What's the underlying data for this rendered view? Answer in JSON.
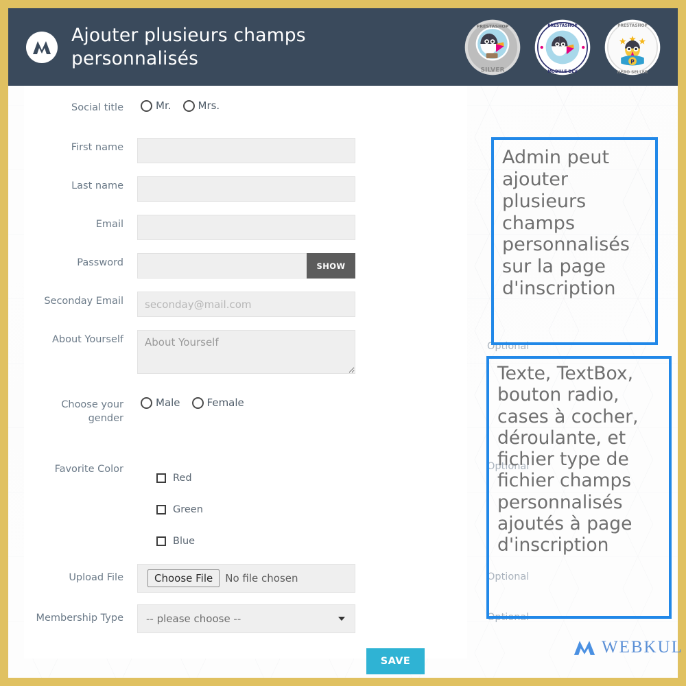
{
  "header": {
    "title": "Ajouter plusieurs champs personnalisés",
    "logo_icon": "webkul-w-icon",
    "badges": [
      {
        "icon": "prestashop-partner-silver-badge",
        "top_text": "PRESTASHOP PARTNER",
        "bottom_text": "SILVER"
      },
      {
        "icon": "prestashop-partner-module-developer-badge",
        "top_text": "PRESTASHOP PARTNER",
        "bottom_text": "MODULE DEVELOPER"
      },
      {
        "icon": "prestashop-super-hero-seller-badge",
        "top_text": "PRESTASHOP",
        "bottom_text": "SUPER HERO SELLER"
      }
    ]
  },
  "form": {
    "social_title": {
      "label": "Social title",
      "options": [
        {
          "label": "Mr.",
          "selected": false
        },
        {
          "label": "Mrs.",
          "selected": false
        }
      ]
    },
    "first_name": {
      "label": "First name",
      "value": "",
      "placeholder": ""
    },
    "last_name": {
      "label": "Last name",
      "value": "",
      "placeholder": ""
    },
    "email": {
      "label": "Email",
      "value": "",
      "placeholder": ""
    },
    "password": {
      "label": "Password",
      "value": "",
      "placeholder": "",
      "show_label": "SHOW"
    },
    "seconday_email": {
      "label": "Seconday Email",
      "value": "",
      "placeholder": "seconday@mail.com"
    },
    "about_yourself": {
      "label": "About Yourself",
      "value": "",
      "placeholder": "About Yourself",
      "optional": "Optional"
    },
    "gender": {
      "label": "Choose your gender",
      "options": [
        {
          "label": "Male",
          "selected": false
        },
        {
          "label": "Female",
          "selected": false
        }
      ]
    },
    "favorite_color": {
      "label": "Favorite Color",
      "optional": "Optional",
      "options": [
        {
          "label": "Red",
          "checked": false
        },
        {
          "label": "Green",
          "checked": false
        },
        {
          "label": "Blue",
          "checked": false
        }
      ]
    },
    "upload_file": {
      "label": "Upload File",
      "button_label": "Choose File",
      "file_name": "No file chosen",
      "optional": "Optional"
    },
    "membership_type": {
      "label": "Membership Type",
      "value": "-- please choose --",
      "optional": "Optional"
    },
    "save_label": "SAVE"
  },
  "callouts": [
    {
      "text": "Admin peut ajouter plusieurs champs personnalisés sur la page d'inscription"
    },
    {
      "text": "Texte, TextBox, bouton radio, cases à cocher, déroulante, et fichier type de fichier champs personnalisés ajoutés à page d'inscription"
    }
  ],
  "footer": {
    "logo_icon": "webkul-w-icon",
    "brand_text": "WEBKUL"
  },
  "colors": {
    "frame": "#e0c161",
    "header_bg": "#3a4a5c",
    "callout_border": "#2188e8",
    "save_button": "#2fb3d4",
    "show_button": "#5c5c5c",
    "brand_blue": "#5a8fd6",
    "field_bg": "#efefef",
    "label_text": "#6b7a88",
    "optional_text": "#aab3bd"
  }
}
